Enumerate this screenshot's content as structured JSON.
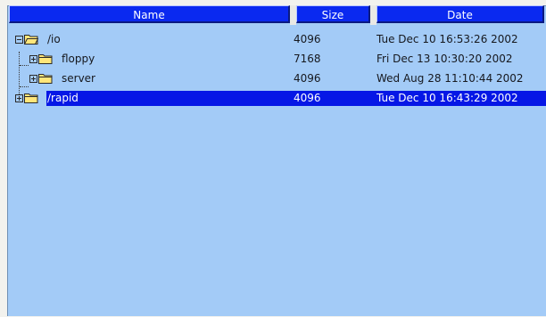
{
  "columns": {
    "name": "Name",
    "size": "Size",
    "date": "Date"
  },
  "rows": [
    {
      "name": "/io",
      "size": "4096",
      "date": "Tue Dec 10 16:53:26 2002",
      "expanded": true,
      "level": 0,
      "selected": false
    },
    {
      "name": "floppy",
      "size": "7168",
      "date": "Fri Dec 13 10:30:20 2002",
      "expanded": false,
      "level": 1,
      "selected": false
    },
    {
      "name": "server",
      "size": "4096",
      "date": "Wed Aug 28 11:10:44 2002",
      "expanded": false,
      "level": 1,
      "selected": false
    },
    {
      "name": "/rapid",
      "size": "4096",
      "date": "Tue Dec 10 16:43:29 2002",
      "expanded": false,
      "level": 0,
      "selected": true
    }
  ],
  "icons": {
    "expanded_folder": "open-folder-icon",
    "collapsed_folder": "folder-icon",
    "collapse": "minus-box-icon",
    "expand": "plus-box-icon"
  },
  "colors": {
    "header_bg": "#0a29f0",
    "list_bg": "#a3cbf7",
    "selection_bg": "#0617e6",
    "folder_fill": "#ffe67a"
  }
}
